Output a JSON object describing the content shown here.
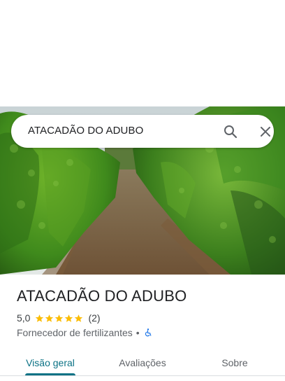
{
  "search": {
    "query": "ATACADÃO DO ADUBO"
  },
  "place": {
    "name": "ATACADÃO DO ADUBO",
    "rating": "5,0",
    "stars": 5,
    "review_count": "(2)",
    "category": "Fornecedor de fertilizantes",
    "separator": "•",
    "accessibility_icon": "wheelchair-icon"
  },
  "tabs": [
    {
      "label": "Visão geral",
      "active": true
    },
    {
      "label": "Avaliações",
      "active": false
    },
    {
      "label": "Sobre",
      "active": false
    }
  ],
  "colors": {
    "accent": "#0b7285",
    "star": "#fbbc04",
    "accessibility": "#1a73e8"
  }
}
